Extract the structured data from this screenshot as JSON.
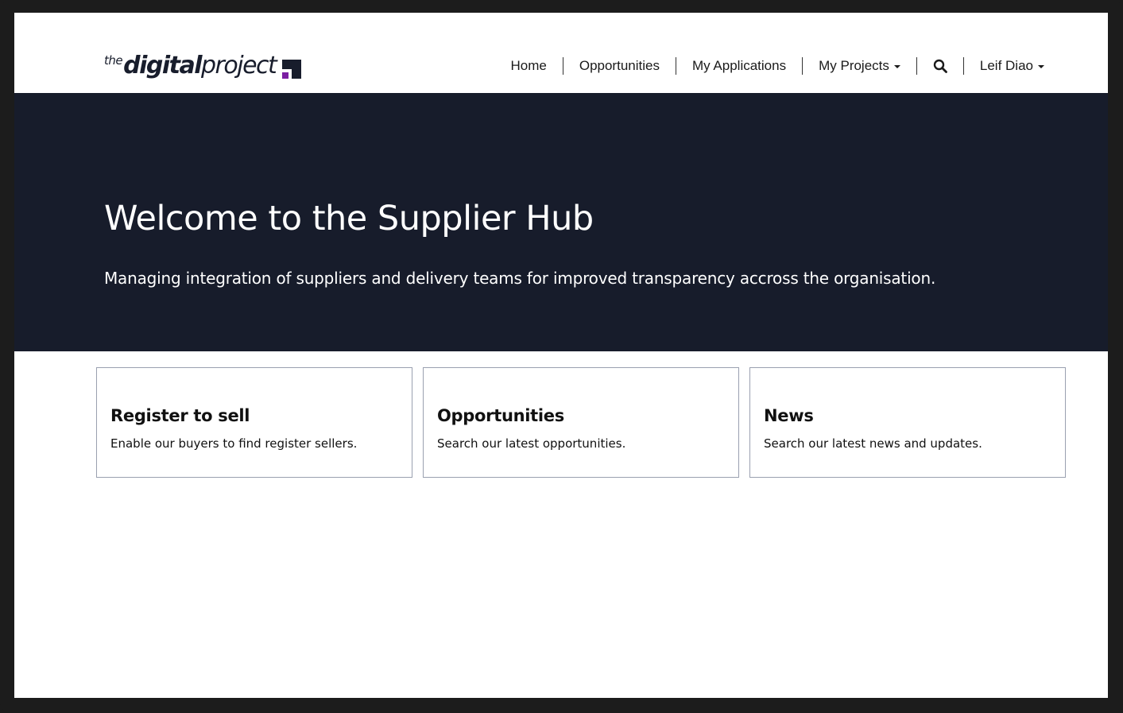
{
  "logo": {
    "the": "the",
    "digital": "digital",
    "project": "project"
  },
  "nav": {
    "home": "Home",
    "opportunities": "Opportunities",
    "my_applications": "My Applications",
    "my_projects": "My Projects",
    "user": "Leif Diao"
  },
  "hero": {
    "title": "Welcome to the Supplier Hub",
    "subtitle": "Managing integration of suppliers and delivery teams for improved transparency accross the organisation."
  },
  "cards": [
    {
      "title": "Register to sell",
      "description": "Enable our buyers to find register sellers."
    },
    {
      "title": "Opportunities",
      "description": "Search our latest opportunities."
    },
    {
      "title": "News",
      "description": "Search our latest news and updates."
    }
  ],
  "colors": {
    "hero_background": "#171c2b",
    "logo_accent": "#7b1fa2",
    "card_border": "#9aa0b0"
  }
}
